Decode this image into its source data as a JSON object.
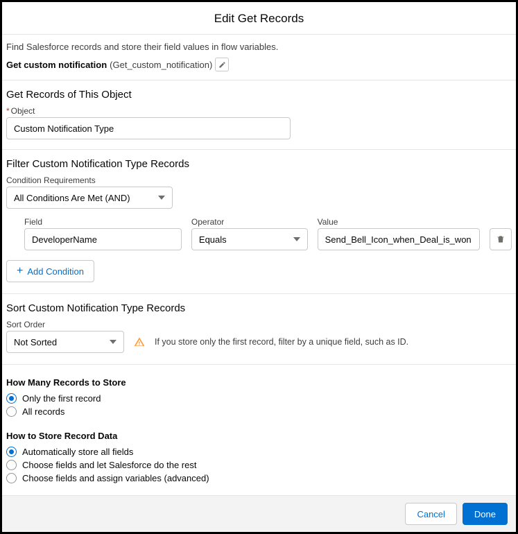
{
  "header": {
    "title": "Edit Get Records"
  },
  "intro": {
    "desc": "Find Salesforce records and store their field values in flow variables.",
    "label_bold": "Get custom notification",
    "label_api": "(Get_custom_notification)"
  },
  "section_object": {
    "title": "Get Records of This Object",
    "field_label": "Object",
    "value": "Custom Notification Type"
  },
  "section_filter": {
    "title": "Filter Custom Notification Type Records",
    "req_label": "Condition Requirements",
    "req_value": "All Conditions Are Met (AND)",
    "cond": {
      "field_label": "Field",
      "field_value": "DeveloperName",
      "op_label": "Operator",
      "op_value": "Equals",
      "val_label": "Value",
      "val_value": "Send_Bell_Icon_when_Deal_is_won"
    },
    "add_label": "Add Condition"
  },
  "section_sort": {
    "title": "Sort Custom Notification Type Records",
    "order_label": "Sort Order",
    "order_value": "Not Sorted",
    "help": "If you store only the first record, filter by a unique field, such as ID."
  },
  "how_many": {
    "title": "How Many Records to Store",
    "opt1": "Only the first record",
    "opt2": "All records"
  },
  "how_store": {
    "title": "How to Store Record Data",
    "opt1": "Automatically store all fields",
    "opt2": "Choose fields and let Salesforce do the rest",
    "opt3": "Choose fields and assign variables (advanced)"
  },
  "footer": {
    "cancel": "Cancel",
    "done": "Done"
  }
}
